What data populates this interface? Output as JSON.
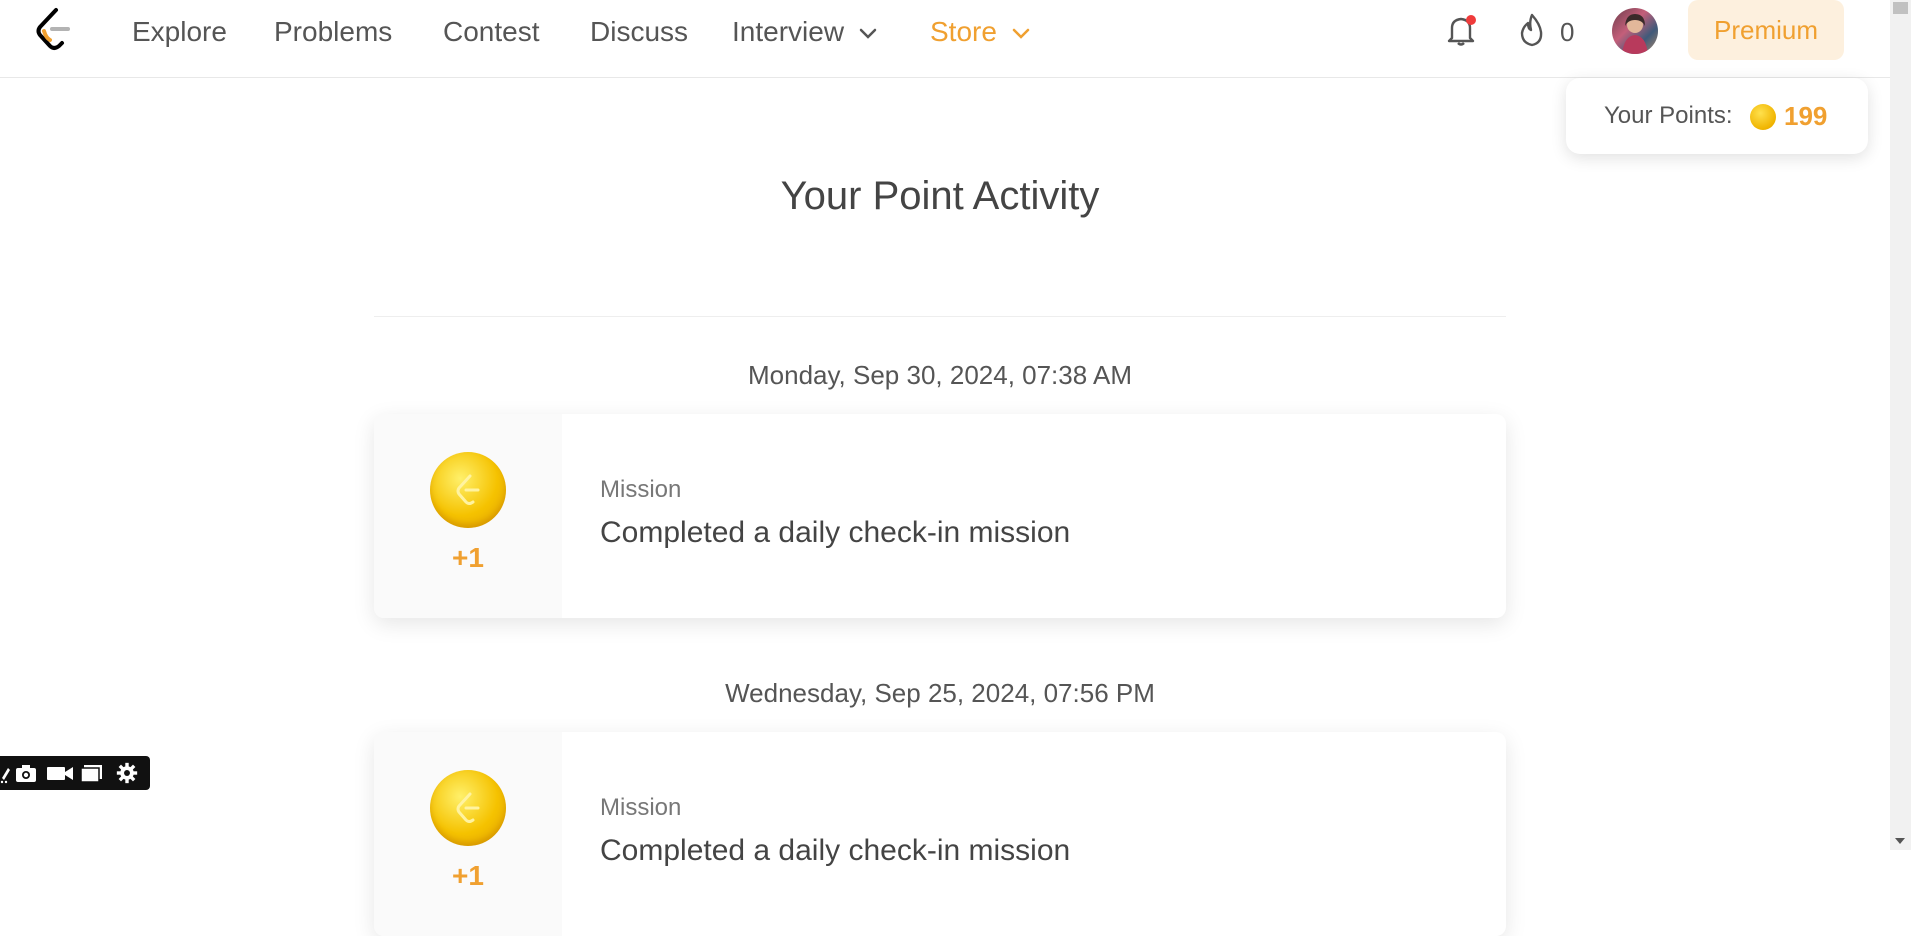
{
  "nav": {
    "items": [
      {
        "label": "Explore"
      },
      {
        "label": "Problems"
      },
      {
        "label": "Contest"
      },
      {
        "label": "Discuss"
      },
      {
        "label": "Interview"
      },
      {
        "label": "Store"
      }
    ],
    "streak_count": "0",
    "premium_label": "Premium"
  },
  "points_popup": {
    "label": "Your Points:",
    "value": "199"
  },
  "main": {
    "title": "Your Point Activity",
    "activities": [
      {
        "date": "Monday, Sep 30, 2024, 07:38 AM",
        "points": "+1",
        "type": "Mission",
        "description": "Completed a daily check-in mission"
      },
      {
        "date": "Wednesday, Sep 25, 2024, 07:56 PM",
        "points": "+1",
        "type": "Mission",
        "description": "Completed a daily check-in mission"
      }
    ]
  },
  "colors": {
    "accent": "#f0a030",
    "premium_bg": "#fdf0de",
    "coin": "#f5c200"
  },
  "icons": {
    "logo": "leetcode-logo-icon",
    "bell": "bell-icon",
    "flame": "flame-icon",
    "chevron": "chevron-down-icon",
    "coin": "coin-icon",
    "devtools": [
      "edit-icon",
      "camera-icon",
      "video-icon",
      "window-icon",
      "gear-icon"
    ]
  }
}
